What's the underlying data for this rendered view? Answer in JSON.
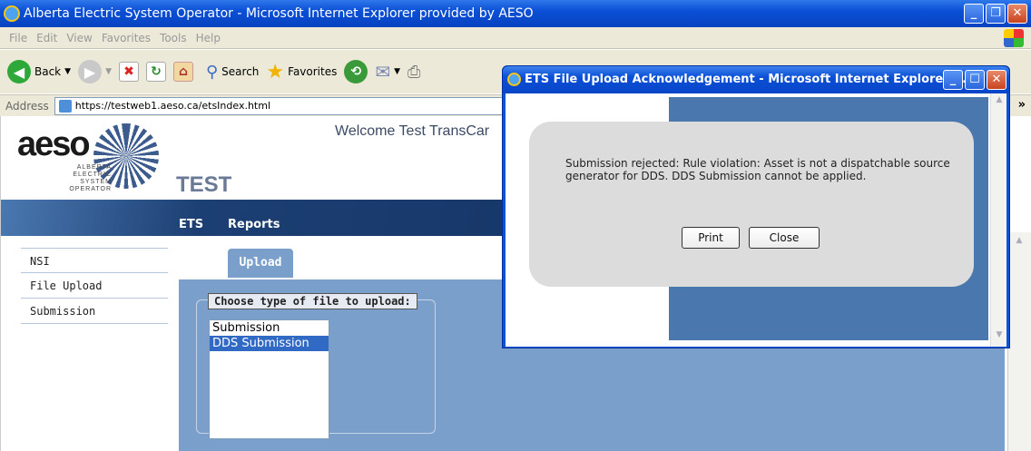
{
  "browser": {
    "title": "Alberta Electric System Operator - Microsoft Internet Explorer provided by AESO",
    "menu": [
      "File",
      "Edit",
      "View",
      "Favorites",
      "Tools",
      "Help"
    ],
    "toolbar": {
      "back": "Back",
      "search": "Search",
      "favorites": "Favorites"
    },
    "address_label": "Address",
    "url": "https://testweb1.aeso.ca/etsIndex.html",
    "more": "»"
  },
  "page": {
    "logo": {
      "text": "aeso",
      "sub": [
        "ALBERTA",
        "ELECTRIC",
        "SYSTEM",
        "OPERATOR"
      ]
    },
    "welcome": "Welcome Test TransCar",
    "env_label": "TEST",
    "nav": [
      "ETS",
      "Reports"
    ],
    "sidebar": [
      "NSI",
      "File Upload",
      "Submission"
    ],
    "tab": "Upload",
    "legend": "Choose type of file to upload:",
    "file_types": [
      "Submission",
      "DDS Submission"
    ],
    "selected_file_type": "DDS Submission"
  },
  "dialog": {
    "title": "ETS File Upload Acknowledgement - Microsoft Internet Explorer ...",
    "message": "Submission rejected: Rule violation: Asset is not a dispatchable source generator for DDS. DDS Submission cannot be applied.",
    "print_label": "Print",
    "close_label": "Close"
  },
  "colors": {
    "titlebar": "#0a4fd6",
    "navbar": "#0f2c5a",
    "panel": "#7b9fcb",
    "selection": "#316ac5"
  }
}
